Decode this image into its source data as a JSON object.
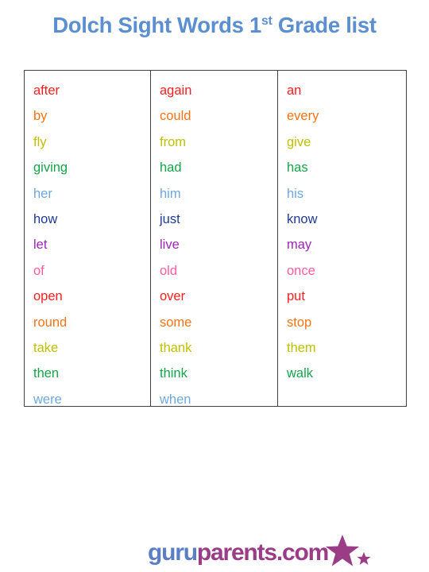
{
  "title": {
    "before": "Dolch Sight Words 1",
    "superscript": "st",
    "after": " Grade list",
    "color": "#5B8FD0"
  },
  "table": {
    "columns": [
      {
        "name": "column-1",
        "words": [
          "after",
          "by",
          "fly",
          "giving",
          "her",
          "how",
          "let",
          "of",
          "open",
          "round",
          "take",
          "then",
          "were"
        ]
      },
      {
        "name": "column-2",
        "words": [
          "again",
          "could",
          "from",
          "had",
          "him",
          "just",
          "live",
          "old",
          "over",
          "some",
          "thank",
          "think",
          "when"
        ]
      },
      {
        "name": "column-3",
        "words": [
          "an",
          "every",
          "give",
          "has",
          "his",
          "know",
          "may",
          "once",
          "put",
          "stop",
          "them",
          "walk"
        ]
      }
    ],
    "word_color_cycle": [
      "#FF1F1F",
      "#F97316",
      "#BFBF00",
      "#14A44A",
      "#6FA8DC",
      "#1F3A93",
      "#9B26B6",
      "#FF5C9E"
    ],
    "border_color": "#3f3f46"
  },
  "footer": {
    "logo_primary": "guru",
    "logo_secondary": "parents.com",
    "primary_color": "#5B7FC7",
    "secondary_color": "#9B3C87",
    "star_color": "#9B3C87"
  }
}
